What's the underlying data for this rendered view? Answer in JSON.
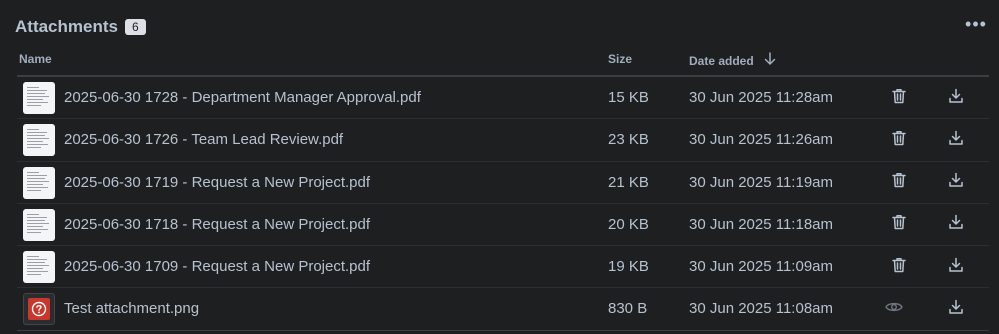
{
  "header": {
    "title": "Attachments",
    "count": "6",
    "more_icon": "more-horizontal-icon"
  },
  "table": {
    "columns": {
      "name": "Name",
      "size": "Size",
      "date": "Date added"
    },
    "sort_icon": "arrow-down-icon",
    "rows": [
      {
        "name": "2025-06-30 1728 - Department Manager Approval.pdf",
        "size": "15 KB",
        "date": "30 Jun 2025 11:28am",
        "type": "pdf",
        "action": "delete"
      },
      {
        "name": "2025-06-30 1726 - Team Lead Review.pdf",
        "size": "23 KB",
        "date": "30 Jun 2025 11:26am",
        "type": "pdf",
        "action": "delete"
      },
      {
        "name": "2025-06-30 1719 - Request a New Project.pdf",
        "size": "21 KB",
        "date": "30 Jun 2025 11:19am",
        "type": "pdf",
        "action": "delete"
      },
      {
        "name": "2025-06-30 1718 - Request a New Project.pdf",
        "size": "20 KB",
        "date": "30 Jun 2025 11:18am",
        "type": "pdf",
        "action": "delete"
      },
      {
        "name": "2025-06-30 1709 - Request a New Project.pdf",
        "size": "19 KB",
        "date": "30 Jun 2025 11:09am",
        "type": "pdf",
        "action": "delete"
      },
      {
        "name": "Test attachment.png",
        "size": "830 B",
        "date": "30 Jun 2025 11:08am",
        "type": "image-broken",
        "action": "view"
      }
    ]
  },
  "colors": {
    "background": "#1e1f21",
    "text": "#b6c2cf",
    "badge_bg": "#dcdfe4",
    "thumb_error": "#c9372c"
  }
}
